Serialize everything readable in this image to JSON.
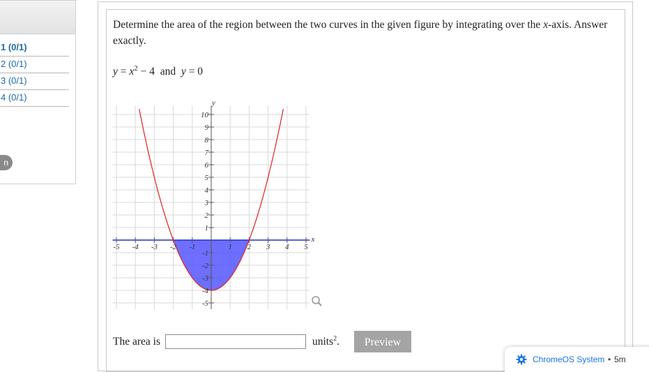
{
  "sidebar": {
    "items": [
      {
        "label": "1 (0/1)",
        "active": true
      },
      {
        "label": "2 (0/1)",
        "active": false
      },
      {
        "label": "3 (0/1)",
        "active": false
      },
      {
        "label": "4 (0/1)",
        "active": false
      }
    ],
    "pill_label": "n"
  },
  "question": {
    "text_before": "Determine the area of the region between the two curves in the given figure by integrating over the ",
    "axis_var": "x",
    "text_after": "-axis. Answer exactly.",
    "eq_y1": "y",
    "eq_eq1": " = ",
    "eq_x": "x",
    "eq_exp": "2",
    "eq_rest": " − 4",
    "eq_and": "  and  ",
    "eq_y2": "y",
    "eq_eq2": " = 0"
  },
  "graph": {
    "x_axis_label": "x",
    "y_axis_label": "y",
    "x_ticks": [
      "-5",
      "-4",
      "-3",
      "-2",
      "-1",
      "1",
      "2",
      "3",
      "4",
      "5"
    ],
    "y_ticks": [
      "10",
      "9",
      "8",
      "7",
      "6",
      "5",
      "4",
      "3",
      "2",
      "1",
      "-1",
      "-2",
      "-3",
      "-4",
      "-5"
    ],
    "zoom_icon": "magnifier-icon",
    "curve_color": "#e02020",
    "fill_color": "#5555ff",
    "axis_color": "#2233cc"
  },
  "answer": {
    "label": "The area is",
    "value": "",
    "units": "units",
    "units_exp": "2",
    "units_end": ".",
    "preview_label": "Preview"
  },
  "notification": {
    "icon": "gear-icon",
    "source": "ChromeOS System",
    "separator": "•",
    "time": "5m"
  }
}
